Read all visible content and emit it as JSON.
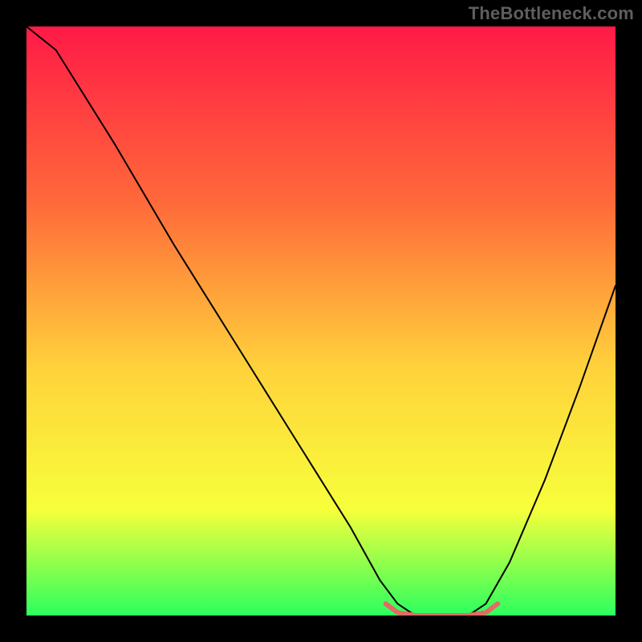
{
  "watermark": "TheBottleneck.com",
  "chart_data": {
    "type": "line",
    "title": "",
    "xlabel": "",
    "ylabel": "",
    "xlim": [
      0,
      100
    ],
    "ylim": [
      0,
      100
    ],
    "background_gradient": {
      "top": "#ff1a47",
      "mid_upper": "#ff6a3a",
      "mid": "#ffd23b",
      "mid_lower": "#f7ff3b",
      "bottom": "#2cff5e"
    },
    "series": [
      {
        "name": "bottleneck-curve",
        "stroke": "#000000",
        "stroke_width": 2,
        "x": [
          0,
          5,
          15,
          25,
          35,
          45,
          55,
          60,
          63,
          66,
          70,
          75,
          78,
          82,
          88,
          94,
          100
        ],
        "values": [
          100,
          96,
          80,
          63,
          47,
          31,
          15,
          6,
          2,
          0,
          0,
          0,
          2,
          9,
          23,
          39,
          56
        ]
      },
      {
        "name": "optimal-zone-marker",
        "stroke": "#e36a65",
        "stroke_width": 6,
        "x": [
          61,
          63,
          66,
          70,
          75,
          78,
          80
        ],
        "values": [
          2,
          0.5,
          0,
          0,
          0,
          0.5,
          2
        ]
      }
    ],
    "grid": false,
    "legend": false
  }
}
